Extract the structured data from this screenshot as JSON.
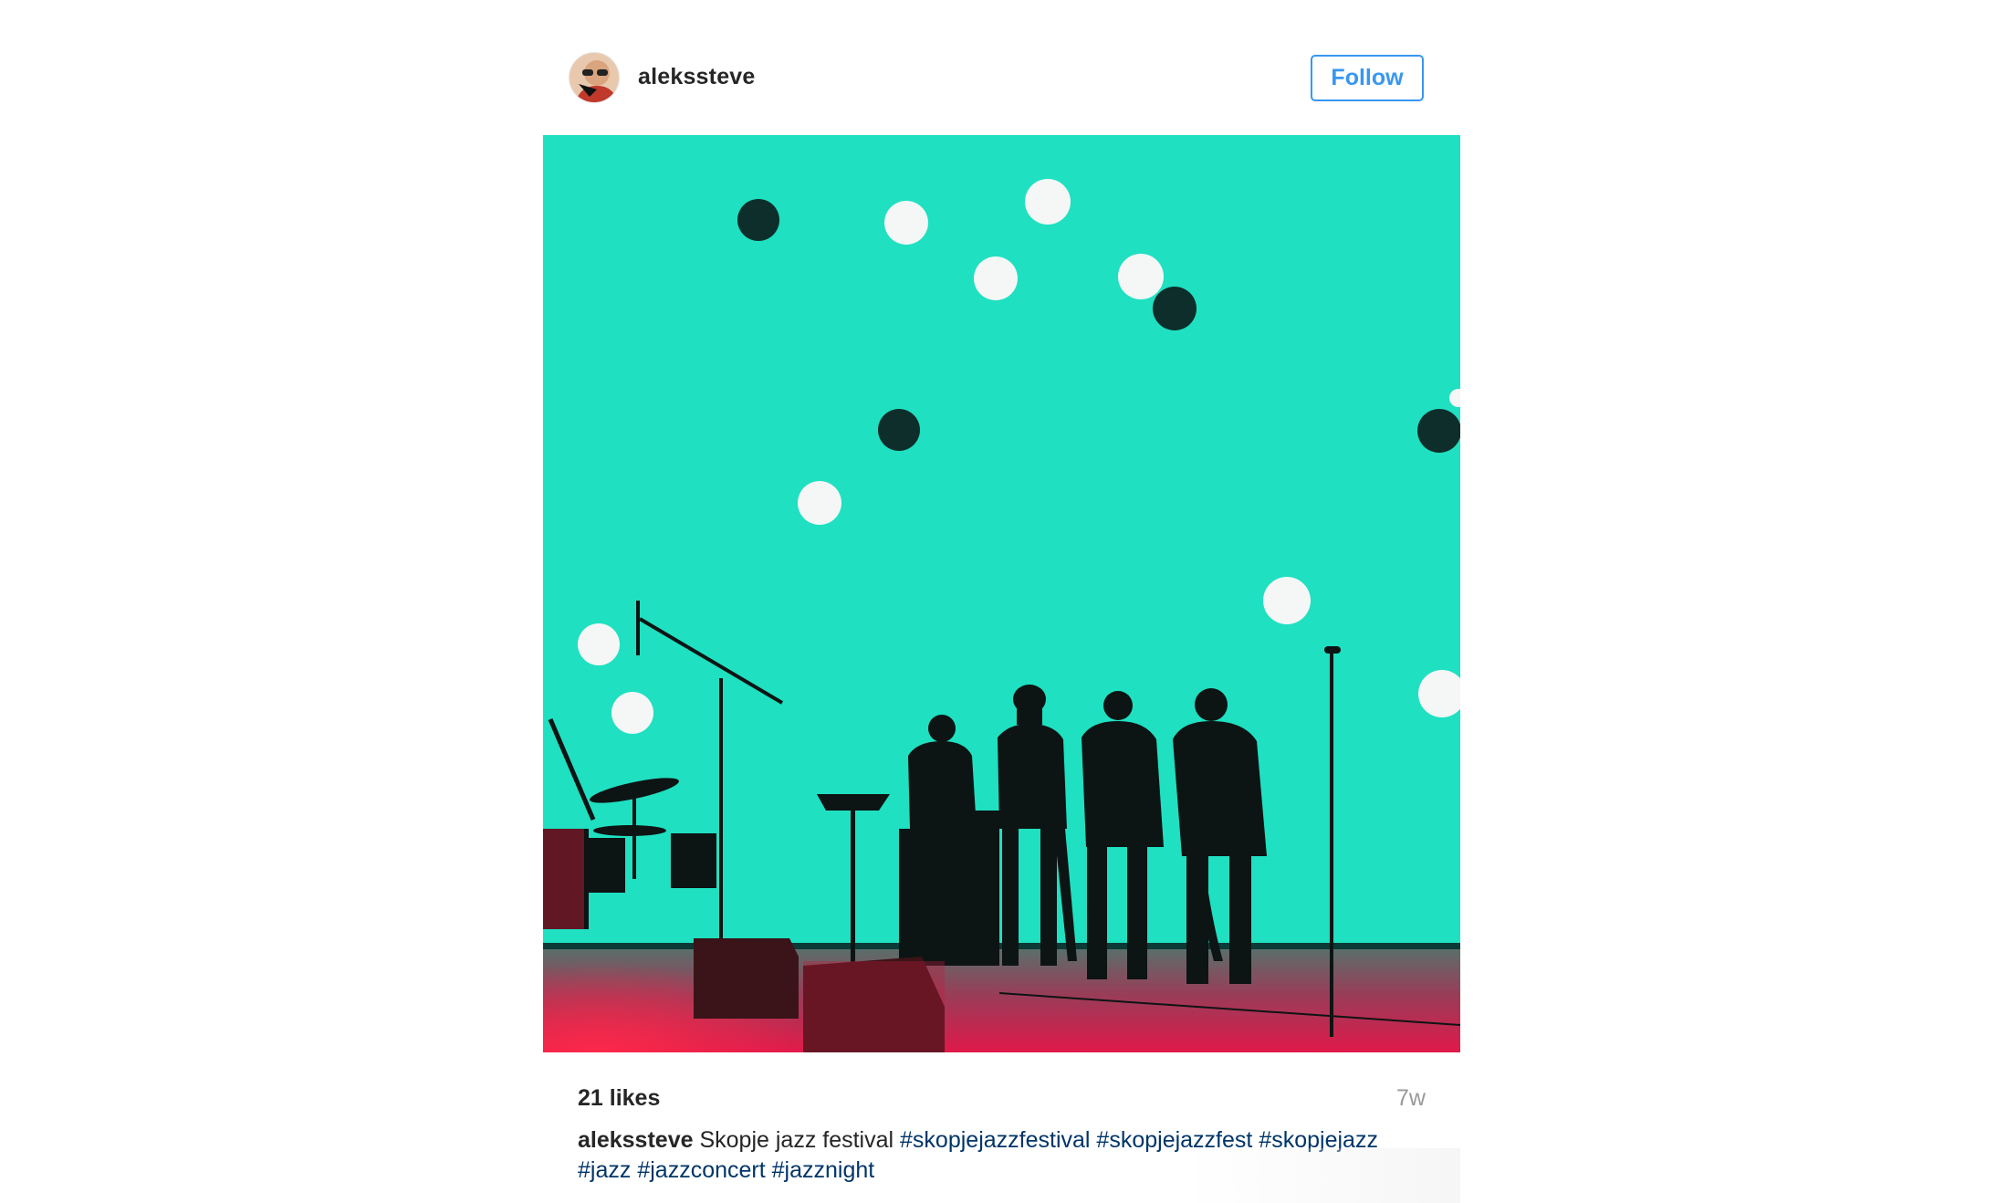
{
  "header": {
    "username": "alekssteve",
    "follow_label": "Follow",
    "avatar_icon": "profile-avatar-icon"
  },
  "photo": {
    "subject": "jazz-band-silhouette-photo",
    "background_color": "#1fe0c1",
    "stage_light_color": "#e0194a"
  },
  "meta": {
    "likes": "21 likes",
    "time_ago": "7w"
  },
  "caption": {
    "username": "alekssteve",
    "text": "Skopje jazz festival",
    "hashtags": [
      "#skopjejazzfestival",
      "#skopjejazzfest",
      "#skopjejazz",
      "#jazz",
      "#jazzconcert",
      "#jazznight"
    ]
  },
  "colors": {
    "accent": "#3897f0",
    "hashtag": "#003569",
    "muted": "#999999",
    "text": "#262626"
  }
}
